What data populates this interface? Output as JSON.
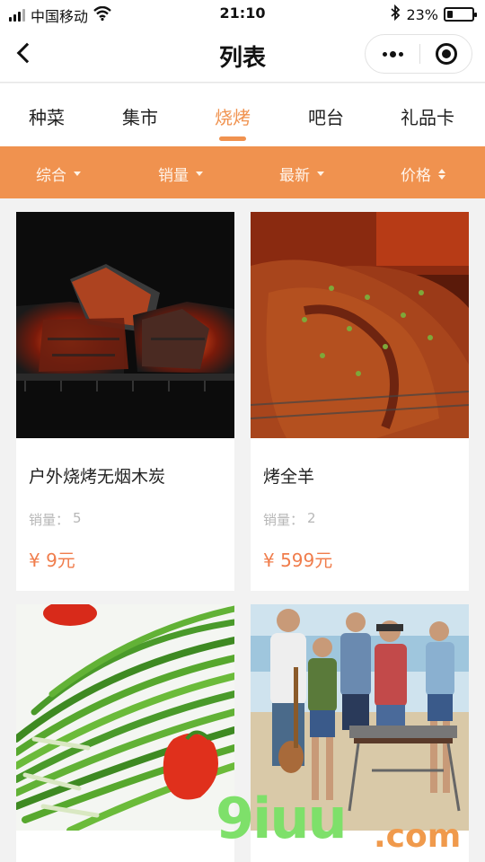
{
  "status_bar": {
    "carrier": "中国移动",
    "time": "21:10",
    "battery": "23%",
    "battery_level": 0.23
  },
  "nav": {
    "title": "列表"
  },
  "tabs": [
    {
      "label": "种菜"
    },
    {
      "label": "集市"
    },
    {
      "label": "烧烤"
    },
    {
      "label": "吧台"
    },
    {
      "label": "礼品卡"
    }
  ],
  "active_tab": "烧烤",
  "filters": [
    {
      "label": "综合"
    },
    {
      "label": "销量"
    },
    {
      "label": "最新"
    },
    {
      "label": "价格"
    }
  ],
  "products": [
    {
      "name": "户外烧烤无烟木炭",
      "sales_label": "销量：",
      "sales": "5",
      "price": "¥ 9元"
    },
    {
      "name": "烤全羊",
      "sales_label": "销量：",
      "sales": "2",
      "price": "¥ 599元"
    },
    {
      "name": "",
      "sales_label": "",
      "sales": "",
      "price": ""
    },
    {
      "name": "",
      "sales_label": "",
      "sales": "",
      "price": ""
    }
  ],
  "watermark": {
    "brand": "9iuu",
    "domain": ".com"
  },
  "colors": {
    "accent": "#f0924f",
    "price": "#f07d4c",
    "muted": "#b7b7b7"
  }
}
